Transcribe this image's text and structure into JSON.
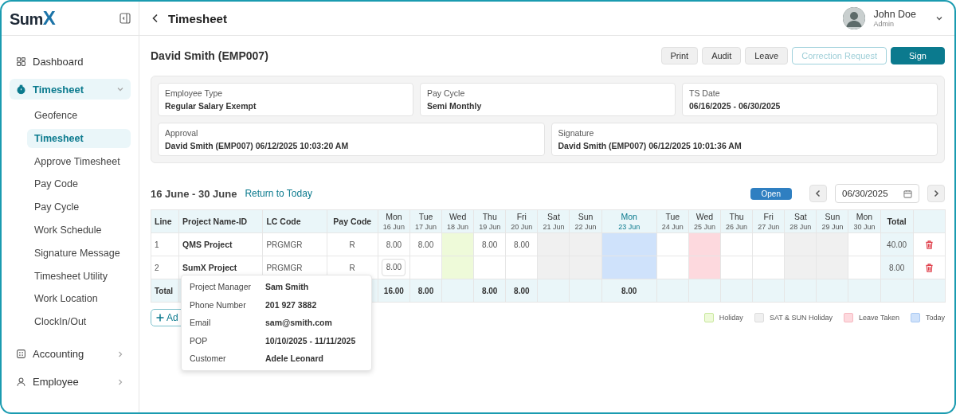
{
  "logo": {
    "text": "Sum",
    "mark": "X"
  },
  "sidebar": {
    "items": [
      {
        "label": "Dashboard",
        "selected": false
      },
      {
        "label": "Timesheet",
        "selected": true,
        "expanded": true,
        "children": [
          {
            "label": "Geofence",
            "selected": false
          },
          {
            "label": "Timesheet",
            "selected": true
          },
          {
            "label": "Approve Timesheet",
            "selected": false
          },
          {
            "label": "Pay Code",
            "selected": false
          },
          {
            "label": "Pay Cycle",
            "selected": false
          },
          {
            "label": "Work Schedule",
            "selected": false
          },
          {
            "label": "Signature Message",
            "selected": false
          },
          {
            "label": "Timesheet Utility",
            "selected": false
          },
          {
            "label": "Work Location",
            "selected": false
          },
          {
            "label": "ClockIn/Out",
            "selected": false
          }
        ]
      },
      {
        "label": "Accounting",
        "selected": false,
        "expanded": false
      },
      {
        "label": "Employee",
        "selected": false,
        "expanded": false
      }
    ]
  },
  "header": {
    "title": "Timesheet",
    "user": {
      "name": "John Doe",
      "role": "Admin"
    }
  },
  "employee": "David Smith (EMP007)",
  "buttons": [
    {
      "label": "Print",
      "kind": "secondary",
      "disabled": false
    },
    {
      "label": "Audit",
      "kind": "secondary",
      "disabled": false
    },
    {
      "label": "Leave",
      "kind": "secondary",
      "disabled": false
    },
    {
      "label": "Correction Request",
      "kind": "outline",
      "disabled": true
    },
    {
      "label": "Sign",
      "kind": "primary",
      "disabled": false
    }
  ],
  "info": [
    [
      {
        "label": "Employee Type",
        "value": "Regular Salary Exempt"
      },
      {
        "label": "Pay Cycle",
        "value": "Semi Monthly"
      },
      {
        "label": "TS Date",
        "value": "06/16/2025 - 06/30/2025"
      }
    ],
    [
      {
        "label": "Approval",
        "value": "David Smith (EMP007) 06/12/2025 10:03:20 AM"
      },
      {
        "label": "Signature",
        "value": "David Smith (EMP007) 06/12/2025 10:01:36 AM"
      }
    ]
  ],
  "period": {
    "range": "16 June - 30 June",
    "link": "Return to Today",
    "status": "Open",
    "date": "06/30/2025"
  },
  "table": {
    "columns": [
      "Line",
      "Project Name-ID",
      "LC Code",
      "Pay Code"
    ],
    "total_column": "Total",
    "days": [
      {
        "dow": "Mon",
        "date": "16 Jun",
        "kind": "work"
      },
      {
        "dow": "Tue",
        "date": "17 Jun",
        "kind": "work"
      },
      {
        "dow": "Wed",
        "date": "18 Jun",
        "kind": "holiday"
      },
      {
        "dow": "Thu",
        "date": "19 Jun",
        "kind": "work"
      },
      {
        "dow": "Fri",
        "date": "20 Jun",
        "kind": "work"
      },
      {
        "dow": "Sat",
        "date": "21 Jun",
        "kind": "weekend"
      },
      {
        "dow": "Sun",
        "date": "22 Jun",
        "kind": "weekend"
      },
      {
        "dow": "Mon",
        "date": "23 Jun",
        "kind": "today"
      },
      {
        "dow": "Tue",
        "date": "24 Jun",
        "kind": "work"
      },
      {
        "dow": "Wed",
        "date": "25 Jun",
        "kind": "leave"
      },
      {
        "dow": "Thu",
        "date": "26 Jun",
        "kind": "work"
      },
      {
        "dow": "Fri",
        "date": "27 Jun",
        "kind": "work"
      },
      {
        "dow": "Sat",
        "date": "28 Jun",
        "kind": "weekend"
      },
      {
        "dow": "Sun",
        "date": "29 Jun",
        "kind": "weekend"
      },
      {
        "dow": "Mon",
        "date": "30 Jun",
        "kind": "work"
      }
    ],
    "rows": [
      {
        "line": "1",
        "project": "QMS Project",
        "lc_code": "PRGMGR",
        "pay_code": "R",
        "total": "40.00",
        "hours": [
          {
            "value": "8.00",
            "kind": "text"
          },
          {
            "value": "8.00",
            "kind": "text"
          },
          {
            "kind": "empty"
          },
          {
            "value": "8.00",
            "kind": "text"
          },
          {
            "value": "8.00",
            "kind": "text"
          },
          {
            "kind": "empty"
          },
          {
            "kind": "empty"
          },
          {
            "kind": "empty"
          },
          {
            "kind": "empty"
          },
          {
            "kind": "empty"
          },
          {
            "kind": "empty"
          },
          {
            "kind": "empty"
          },
          {
            "kind": "empty"
          },
          {
            "kind": "empty"
          },
          {
            "kind": "empty"
          }
        ]
      },
      {
        "line": "2",
        "project": "SumX Project",
        "lc_code": "PRGMGR",
        "pay_code": "R",
        "total": "8.00",
        "hours": [
          {
            "value": "8.00",
            "kind": "input"
          },
          {
            "kind": "empty"
          },
          {
            "kind": "empty"
          },
          {
            "kind": "empty"
          },
          {
            "kind": "empty"
          },
          {
            "kind": "empty"
          },
          {
            "kind": "empty"
          },
          {
            "kind": "empty"
          },
          {
            "kind": "empty"
          },
          {
            "kind": "empty"
          },
          {
            "kind": "empty"
          },
          {
            "kind": "empty"
          },
          {
            "kind": "empty"
          },
          {
            "kind": "empty"
          },
          {
            "kind": "empty"
          }
        ]
      }
    ],
    "total_row": {
      "label": "Total",
      "hours": [
        {
          "value": "16.00",
          "kind": "text"
        },
        {
          "value": "8.00",
          "kind": "text"
        },
        {
          "kind": "empty"
        },
        {
          "value": "8.00",
          "kind": "text"
        },
        {
          "value": "8.00",
          "kind": "text"
        },
        {
          "kind": "empty"
        },
        {
          "kind": "empty"
        },
        {
          "value": "8.00",
          "kind": "text"
        },
        {
          "kind": "empty"
        },
        {
          "kind": "empty"
        },
        {
          "kind": "empty"
        },
        {
          "kind": "empty"
        },
        {
          "kind": "empty"
        },
        {
          "kind": "empty"
        },
        {
          "kind": "empty"
        }
      ]
    }
  },
  "add_button": "Ad",
  "legend": [
    {
      "label": "Holiday",
      "kind": "holiday"
    },
    {
      "label": "SAT & SUN Holiday",
      "kind": "weekend"
    },
    {
      "label": "Leave Taken",
      "kind": "leave"
    },
    {
      "label": "Today",
      "kind": "today"
    }
  ],
  "popover": [
    {
      "label": "Project Manager",
      "value": "Sam Smith"
    },
    {
      "label": "Phone Number",
      "value": "201 927 3882"
    },
    {
      "label": "Email",
      "value": "sam@smith.com"
    },
    {
      "label": "POP",
      "value": "10/10/2025 - 11/11/2025"
    },
    {
      "label": "Customer",
      "value": "Adele Leonard"
    }
  ]
}
